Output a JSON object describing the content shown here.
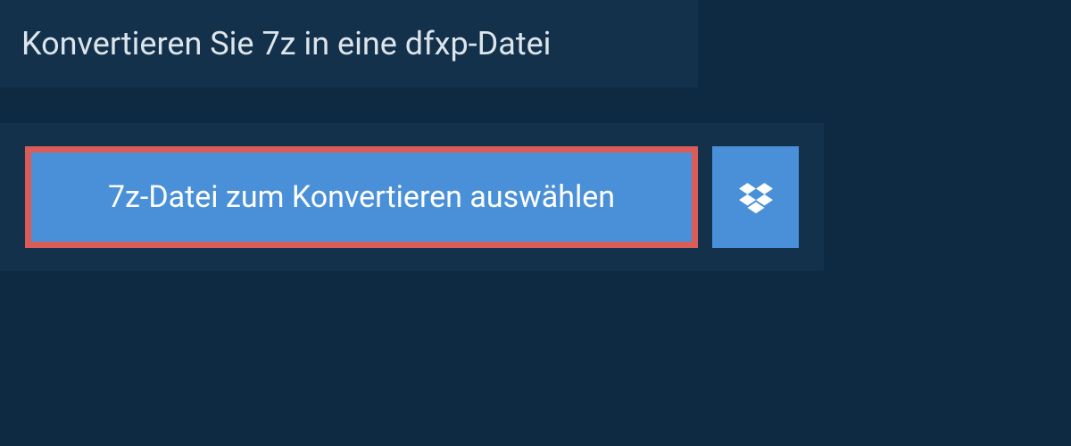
{
  "header": {
    "title": "Konvertieren Sie 7z in eine dfxp-Datei"
  },
  "actions": {
    "select_file_label": "7z-Datei zum Konvertieren auswählen",
    "dropbox_icon": "dropbox-icon"
  }
}
